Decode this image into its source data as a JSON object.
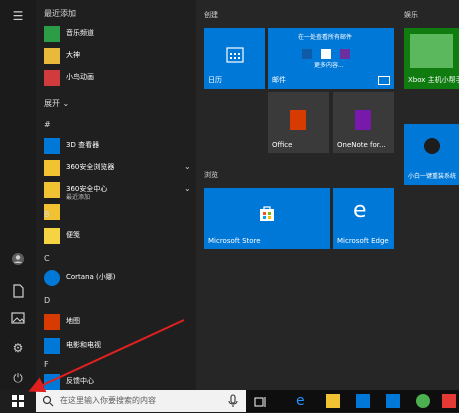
{
  "left_rail": {
    "icons": [
      "hamburger-icon",
      "user-icon",
      "document-icon",
      "pictures-icon",
      "settings-icon",
      "power-icon"
    ]
  },
  "app_list": {
    "recent_header": "最近添加",
    "recent": [
      {
        "label": "音乐频道",
        "icon": "music-channel-icon"
      },
      {
        "label": "大神",
        "icon": "dashen-icon"
      },
      {
        "label": "小鸟动画",
        "icon": "bird-animation-icon"
      }
    ],
    "expand_label": "展开",
    "sections": [
      {
        "letter": "#",
        "items": [
          {
            "label": "3D 查看器",
            "icon": "3d-viewer-icon",
            "chevron": false
          },
          {
            "label": "360安全浏览器",
            "icon": "folder-icon",
            "chevron": true
          },
          {
            "label": "360安全中心",
            "icon": "folder-icon",
            "chevron": true,
            "sub": "最近添加"
          },
          {
            "label": "",
            "icon": "folder-icon",
            "chevron": false
          }
        ]
      },
      {
        "letter": "B",
        "items": [
          {
            "label": "便笺",
            "icon": "sticky-notes-icon",
            "chevron": false
          }
        ]
      },
      {
        "letter": "C",
        "items": [
          {
            "label": "Cortana (小娜)",
            "icon": "cortana-icon",
            "chevron": false
          }
        ]
      },
      {
        "letter": "D",
        "items": [
          {
            "label": "地图",
            "icon": "maps-icon",
            "chevron": false
          },
          {
            "label": "电影和电视",
            "icon": "movies-tv-icon",
            "chevron": false
          }
        ]
      },
      {
        "letter": "F",
        "items": [
          {
            "label": "反馈中心",
            "icon": "feedback-icon",
            "chevron": false
          }
        ]
      }
    ]
  },
  "tiles": {
    "groups": [
      {
        "title": "创建"
      },
      {
        "title": "浏览"
      },
      {
        "title": "娱乐"
      }
    ],
    "calendar_label": "日历",
    "mail_label": "邮件",
    "mail_text": "在一处查看所有邮件",
    "mail_more": "更多内容...",
    "office_label": "Office",
    "onenote_label": "OneNote for...",
    "store_label": "Microsoft Store",
    "edge_label": "Microsoft Edge",
    "xbox_label": "Xbox 主机小帮手",
    "xiaobai_label": "小白一键重装系统"
  },
  "taskbar": {
    "search_placeholder": "在这里输入你要搜索的内容",
    "icons": [
      "start-icon",
      "search-icon",
      "microphone-icon",
      "task-view-icon",
      "edge-icon",
      "file-explorer-icon",
      "store-icon",
      "mail-icon",
      "360-icon",
      "extra-icon"
    ]
  },
  "colors": {
    "accent": "#0078d7",
    "taskbar": "#0e0e0e",
    "arrow": "#e02020"
  }
}
